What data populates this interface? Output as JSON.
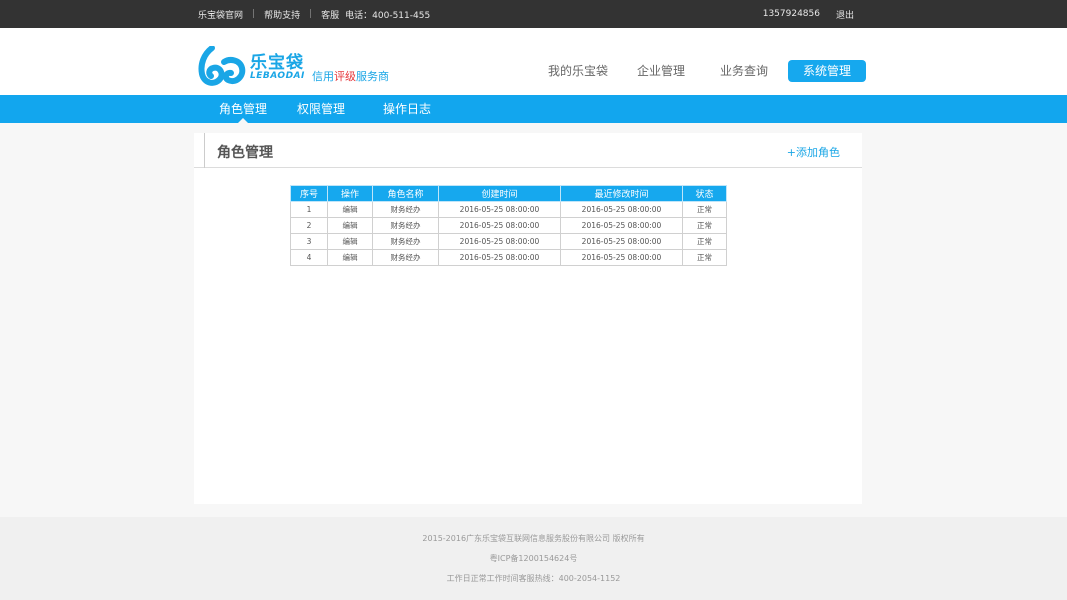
{
  "topbar": {
    "links": [
      "乐宝袋官网",
      "帮助支持",
      "客服"
    ],
    "phone": "电话：400-511-455",
    "account": "1357924856",
    "logout": "退出"
  },
  "logo": {
    "brand": "乐宝袋",
    "en": "LEBAODAI",
    "slogan_a": "信用",
    "slogan_b": "评级",
    "slogan_c": "服务商"
  },
  "mainnav": [
    "我的乐宝袋",
    "企业管理",
    "业务查询",
    "系统管理"
  ],
  "subnav": [
    "角色管理",
    "权限管理",
    "操作日志"
  ],
  "panel": {
    "title": "角色管理",
    "add_button": "+添加角色"
  },
  "table": {
    "headers": [
      "序号",
      "操作",
      "角色名称",
      "创建时间",
      "最近修改时间",
      "状态"
    ],
    "rows": [
      [
        "1",
        "编辑",
        "财务经办",
        "2016-05-25 08:00:00",
        "2016-05-25 08:00:00",
        "正常"
      ],
      [
        "2",
        "编辑",
        "财务经办",
        "2016-05-25 08:00:00",
        "2016-05-25 08:00:00",
        "正常"
      ],
      [
        "3",
        "编辑",
        "财务经办",
        "2016-05-25 08:00:00",
        "2016-05-25 08:00:00",
        "正常"
      ],
      [
        "4",
        "编辑",
        "财务经办",
        "2016-05-25 08:00:00",
        "2016-05-25 08:00:00",
        "正常"
      ]
    ]
  },
  "footer": {
    "copyright": "2015-2016广东乐宝袋互联网信息服务股份有限公司 版权所有",
    "icp": "粤ICP备1200154624号",
    "hotline": "工作日正常工作时间客服热线：400-2054-1152"
  },
  "colors": {
    "accent": "#16a8ee",
    "topbar": "#333333",
    "slogan_red": "#e6353a"
  }
}
